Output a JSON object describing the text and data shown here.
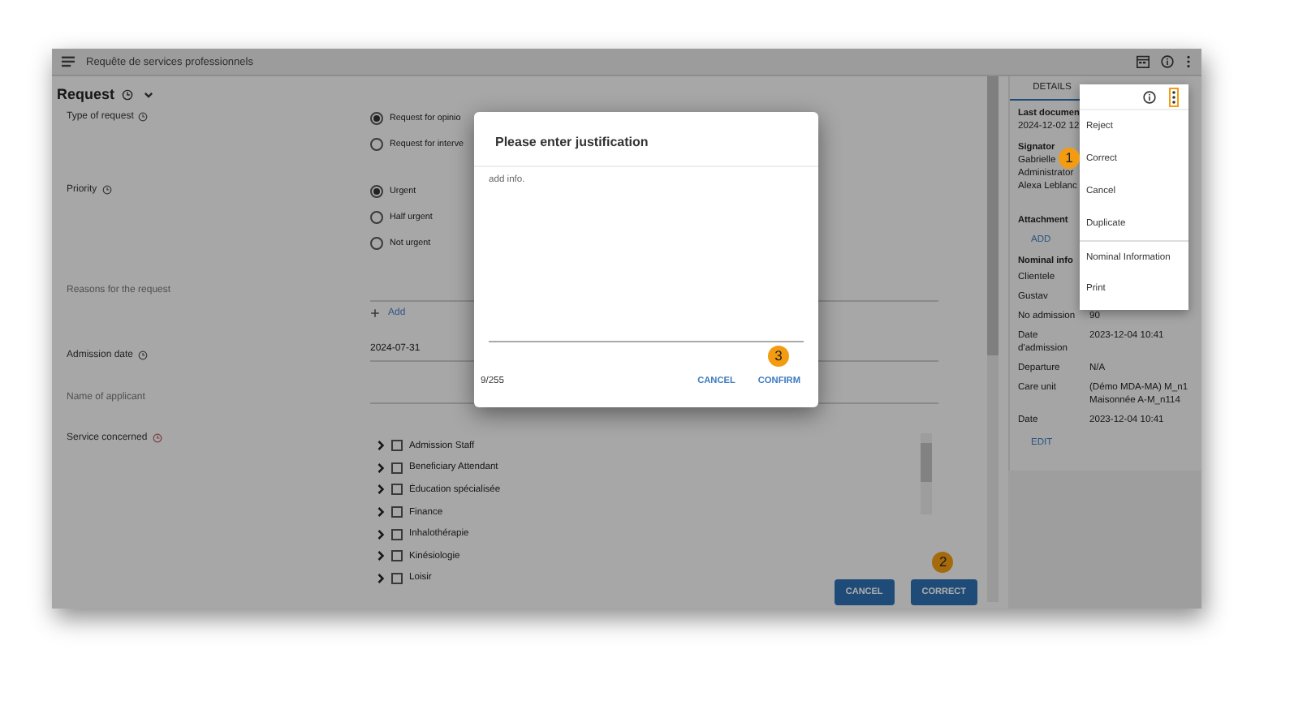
{
  "app_bar": {
    "title": "Requête de services professionnels"
  },
  "section": {
    "title": "Request",
    "expanded": true
  },
  "form": {
    "type_of_request": {
      "label": "Type of request",
      "options": [
        {
          "label": "Request for opinio",
          "selected": true
        },
        {
          "label": "Request for interve",
          "selected": false
        }
      ]
    },
    "priority": {
      "label": "Priority",
      "options": [
        {
          "label": "Urgent",
          "selected": true
        },
        {
          "label": "Half urgent",
          "selected": false
        },
        {
          "label": "Not urgent",
          "selected": false
        }
      ]
    },
    "reasons": {
      "label": "Reasons for the request",
      "add_label": "Add"
    },
    "admission_date": {
      "label": "Admission date",
      "value": "2024-07-31"
    },
    "name_of_applicant": {
      "label": "Name of applicant"
    },
    "service_concerned": {
      "label": "Service concerned",
      "items": [
        {
          "label": "Admission Staff",
          "checked": false
        },
        {
          "label": "Beneficiary Attendant",
          "checked": false
        },
        {
          "label": "Éducation spécialisée",
          "checked": false
        },
        {
          "label": "Finance",
          "checked": false
        },
        {
          "label": "Inhalothérapie",
          "checked": false
        },
        {
          "label": "Kinésiologie",
          "checked": false
        },
        {
          "label": "Loisir",
          "checked": false
        }
      ]
    }
  },
  "footer_buttons": [
    {
      "label": "CANCEL"
    },
    {
      "label": "CORRECT",
      "callout": "2"
    }
  ],
  "details_panel": {
    "tab": "DETAILS",
    "last_document": {
      "label": "Last documen",
      "value": "2024-12-02 12"
    },
    "signatories": {
      "label": "Signator",
      "names": [
        "Gabrielle",
        "Administrator",
        "Alexa Leblanc"
      ]
    },
    "attachment": {
      "label": "Attachment",
      "action": "ADD"
    },
    "nominal": {
      "label": "Nominal info",
      "rows": [
        {
          "label": "Clientele"
        },
        {
          "label": "Gustav"
        },
        {
          "label": "No admission",
          "value": "90"
        },
        {
          "label": "Date d'admission",
          "value": "2023-12-04 10:41"
        },
        {
          "label": "Departure",
          "value": "N/A"
        },
        {
          "label": "Care unit",
          "value": "(Démo MDA-MA) M_n1 Maisonnée A-M_n114"
        },
        {
          "label": "Date",
          "value": "2023-12-04 10:41"
        }
      ],
      "action": "EDIT"
    }
  },
  "menu": {
    "items": [
      {
        "label": "Reject",
        "divider_before": false
      },
      {
        "label": "Correct",
        "divider_before": false,
        "callout": "1"
      },
      {
        "label": "Cancel",
        "divider_before": false
      },
      {
        "label": "Duplicate",
        "divider_before": false
      },
      {
        "label": "Nominal Information",
        "divider_before": true
      },
      {
        "label": "Print",
        "divider_before": false
      }
    ]
  },
  "dialog": {
    "title": "Please enter justification",
    "value": "add info.",
    "counter": "9/255",
    "buttons": [
      {
        "label": "CANCEL"
      },
      {
        "label": "CONFIRM",
        "callout": "3"
      }
    ]
  }
}
